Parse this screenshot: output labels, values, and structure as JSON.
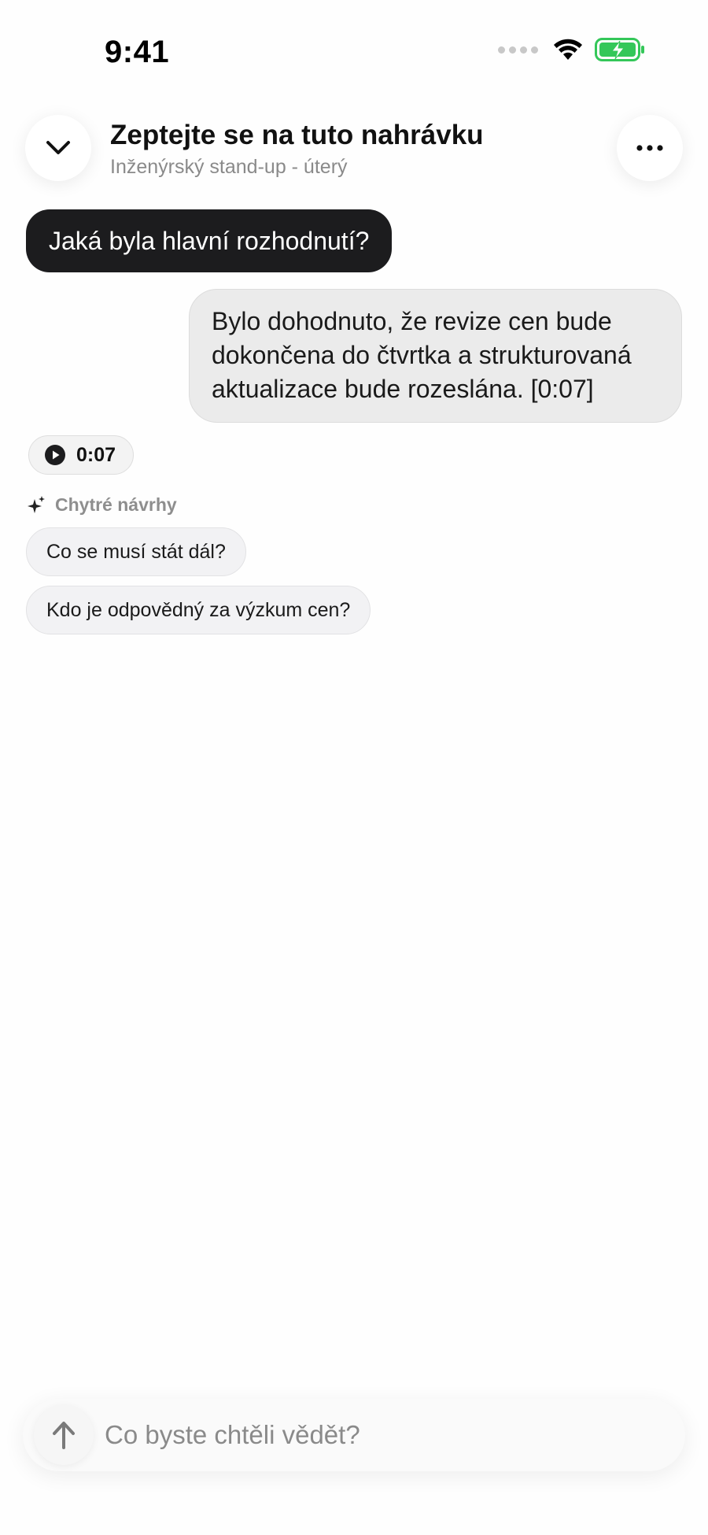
{
  "status_bar": {
    "time": "9:41",
    "icons": [
      "cellular-signal-icon",
      "wifi-icon",
      "battery-charging-icon"
    ],
    "battery_color": "#34c759"
  },
  "header": {
    "title": "Zeptejte se na tuto nahrávku",
    "subtitle": "Inženýrský stand-up - úterý",
    "back_icon": "chevron-down-icon",
    "menu_icon": "ellipsis-icon"
  },
  "chat": {
    "question": "Jaká byla hlavní rozhodnutí?",
    "answer": "Bylo dohodnuto, že revize cen bude dokončena do čtvrtka a strukturovaná aktualizace bude rozeslána. [0:07]",
    "playback": {
      "icon": "play-icon",
      "timestamp": "0:07"
    }
  },
  "suggestions": {
    "icon": "sparkles-icon",
    "label": "Chytré návrhy",
    "items": [
      "Co se musí stát dál?",
      "Kdo je odpovědný za výzkum cen?"
    ]
  },
  "composer": {
    "send_icon": "arrow-up-icon",
    "placeholder": "Co byste chtěli vědět?",
    "value": ""
  },
  "colors": {
    "user_bubble": "#1c1c1e",
    "answer_bubble": "#ebebeb",
    "muted_text": "#8a8a8a"
  }
}
